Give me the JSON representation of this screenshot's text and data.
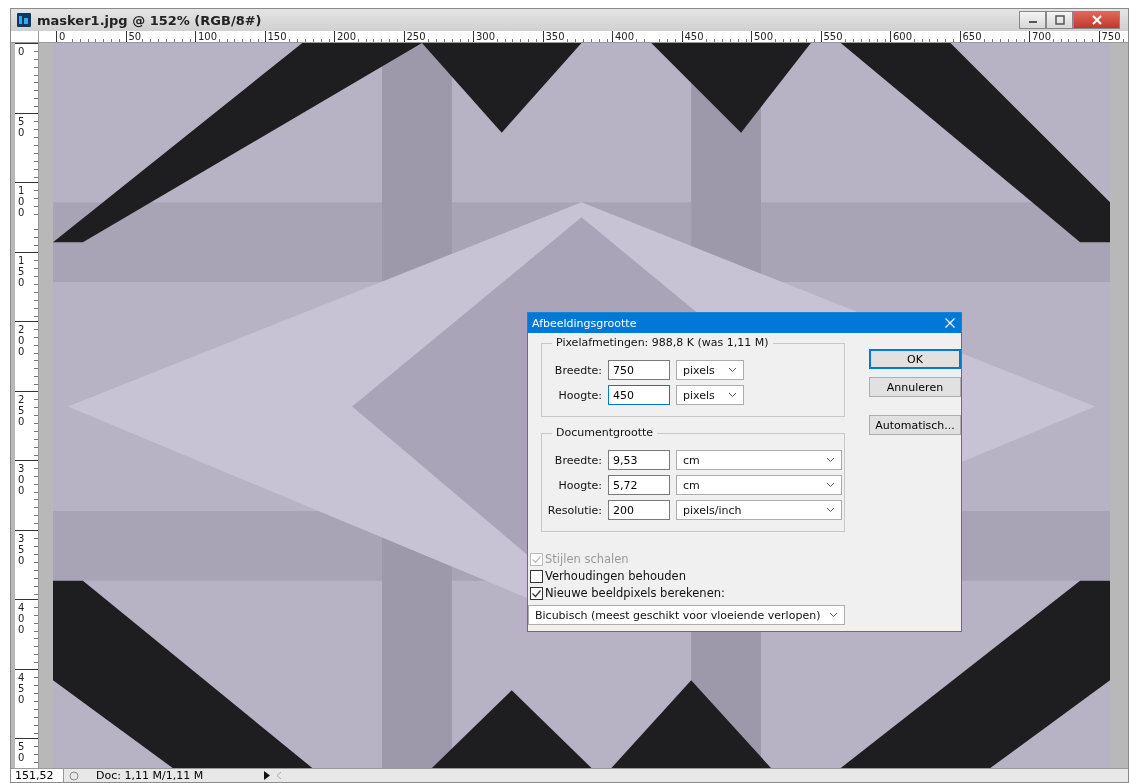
{
  "window": {
    "title": "masker1.jpg @ 152% (RGB/8#)"
  },
  "rulers": {
    "horizontal": [
      "0",
      "50",
      "100",
      "150",
      "200",
      "250",
      "300",
      "350",
      "400",
      "450",
      "500",
      "550",
      "600",
      "650",
      "700",
      "750"
    ],
    "vertical": [
      "0",
      "50",
      "100",
      "150",
      "200",
      "250",
      "300",
      "350",
      "400",
      "450",
      "50"
    ]
  },
  "status_bar": {
    "zoom": "151,52",
    "doc": "Doc: 1,11 M/1,11 M"
  },
  "dialog": {
    "title": "Afbeeldingsgrootte",
    "pixel_group": {
      "legend": "Pixelafmetingen:  988,8 K (was 1,11 M)",
      "fields": [
        {
          "label": "Breedte:",
          "value": "750",
          "unit": "pixels",
          "focused": false
        },
        {
          "label": "Hoogte:",
          "value": "450",
          "unit": "pixels",
          "focused": true
        }
      ]
    },
    "document_group": {
      "legend": "Documentgrootte",
      "fields": [
        {
          "label": "Breedte:",
          "value": "9,53",
          "unit": "cm",
          "focused": false
        },
        {
          "label": "Hoogte:",
          "value": "5,72",
          "unit": "cm",
          "focused": false
        },
        {
          "label": "Resolutie:",
          "value": "200",
          "unit": "pixels/inch",
          "focused": false
        }
      ]
    },
    "checkboxes": [
      {
        "label": "Stijlen schalen",
        "checked": true,
        "disabled": true
      },
      {
        "label": "Verhoudingen behouden",
        "checked": false,
        "disabled": false
      },
      {
        "label": "Nieuwe beeldpixels berekenen:",
        "checked": true,
        "disabled": false
      }
    ],
    "resample": "Bicubisch (meest geschikt voor vloeiende verlopen)",
    "buttons": [
      {
        "label": "OK",
        "default": true
      },
      {
        "label": "Annuleren",
        "default": false
      },
      {
        "label": "Automatisch...",
        "default": false
      }
    ]
  }
}
